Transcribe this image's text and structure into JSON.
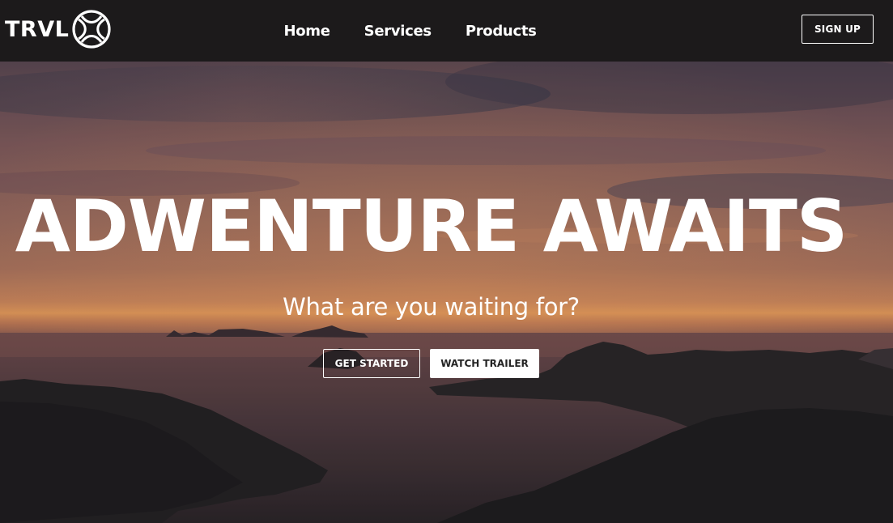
{
  "navbar": {
    "logo_text": "TRVL",
    "logo_icon": "globe-icon",
    "links": [
      {
        "label": "Home"
      },
      {
        "label": "Services"
      },
      {
        "label": "Products"
      }
    ],
    "signup_label": "SIGN UP"
  },
  "hero": {
    "title": "ADWENTURE AWAITS",
    "subtitle": "What are you waiting for?",
    "get_started_label": "GET STARTED",
    "watch_trailer_label": "WATCH TRAILER"
  },
  "colors": {
    "navbar_bg": "#1c1a1b",
    "text": "#ffffff",
    "button_solid_text": "#242424"
  }
}
